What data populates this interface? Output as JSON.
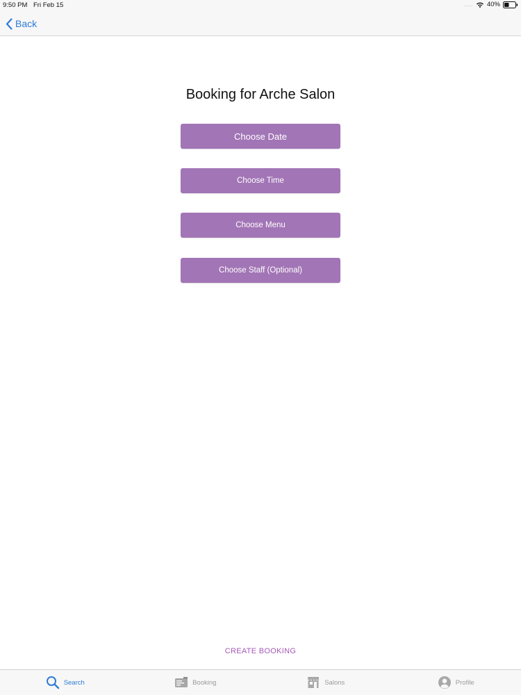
{
  "status_bar": {
    "time": "9:50 PM",
    "date": "Fri Feb 15",
    "signal": ".....",
    "battery_percent": "40%"
  },
  "nav": {
    "back_label": "Back"
  },
  "page": {
    "title": "Booking for Arche Salon",
    "buttons": [
      {
        "label": "Choose Date"
      },
      {
        "label": "Choose Time"
      },
      {
        "label": "Choose Menu"
      },
      {
        "label": "Choose Staff (Optional)"
      }
    ],
    "create_booking_label": "CREATE BOOKING"
  },
  "tab_bar": {
    "active": "Search",
    "tabs": [
      {
        "label": "Search",
        "icon": "search-icon"
      },
      {
        "label": "Booking",
        "icon": "booking-icon"
      },
      {
        "label": "Salons",
        "icon": "salons-icon"
      },
      {
        "label": "Profile",
        "icon": "profile-icon"
      }
    ]
  },
  "colors": {
    "accent_blue": "#2f7bd6",
    "button_purple": "#a275b6",
    "link_purple": "#a659b8",
    "inactive_gray": "#9a9a9a"
  }
}
